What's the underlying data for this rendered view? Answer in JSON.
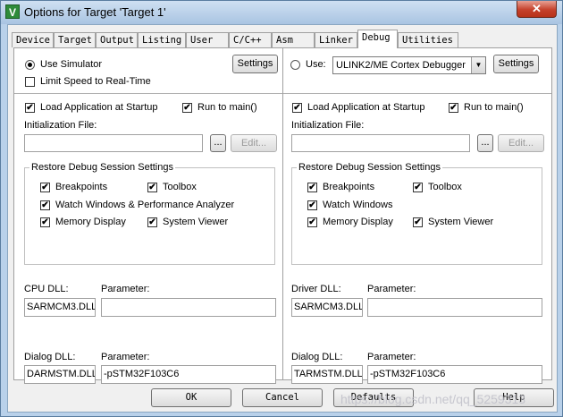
{
  "window": {
    "title": "Options for Target 'Target 1'",
    "icon_text": "V",
    "close_glyph": "✕"
  },
  "tabs": [
    "Device",
    "Target",
    "Output",
    "Listing",
    "User",
    "C/C++",
    "Asm",
    "Linker",
    "Debug",
    "Utilities"
  ],
  "active_tab": "Debug",
  "left": {
    "use_simulator": "Use Simulator",
    "settings": "Settings",
    "limit_speed": "Limit Speed to Real-Time",
    "load_app": "Load Application at Startup",
    "run_to_main": "Run to main()",
    "init_file_label": "Initialization File:",
    "init_file_value": "",
    "browse": "...",
    "edit": "Edit...",
    "restore_title": "Restore Debug Session Settings",
    "breakpoints": "Breakpoints",
    "toolbox": "Toolbox",
    "watch_windows": "Watch Windows & Performance Analyzer",
    "memory_display": "Memory Display",
    "system_viewer": "System Viewer",
    "cpu_dll_label": "CPU DLL:",
    "cpu_dll_value": "SARMCM3.DLL",
    "cpu_param_label": "Parameter:",
    "cpu_param_value": "",
    "dialog_dll_label": "Dialog DLL:",
    "dialog_dll_value": "DARMSTM.DLL",
    "dialog_param_label": "Parameter:",
    "dialog_param_value": "-pSTM32F103C6"
  },
  "right": {
    "use": "Use:",
    "debugger": "ULINK2/ME Cortex Debugger",
    "settings": "Settings",
    "load_app": "Load Application at Startup",
    "run_to_main": "Run to main()",
    "init_file_label": "Initialization File:",
    "init_file_value": "",
    "browse": "...",
    "edit": "Edit...",
    "restore_title": "Restore Debug Session Settings",
    "breakpoints": "Breakpoints",
    "toolbox": "Toolbox",
    "watch_windows": "Watch Windows",
    "memory_display": "Memory Display",
    "system_viewer": "System Viewer",
    "driver_dll_label": "Driver DLL:",
    "driver_dll_value": "SARMCM3.DLL",
    "driver_param_label": "Parameter:",
    "driver_param_value": "",
    "dialog_dll_label": "Dialog DLL:",
    "dialog_dll_value": "TARMSTM.DLL",
    "dialog_param_label": "Parameter:",
    "dialog_param_value": "-pSTM32F103C6"
  },
  "buttons": {
    "ok": "OK",
    "cancel": "Cancel",
    "defaults": "Defaults",
    "help": "Help"
  },
  "check_glyph": "✔",
  "watermark": "https://blog.csdn.net/qq_5259313"
}
